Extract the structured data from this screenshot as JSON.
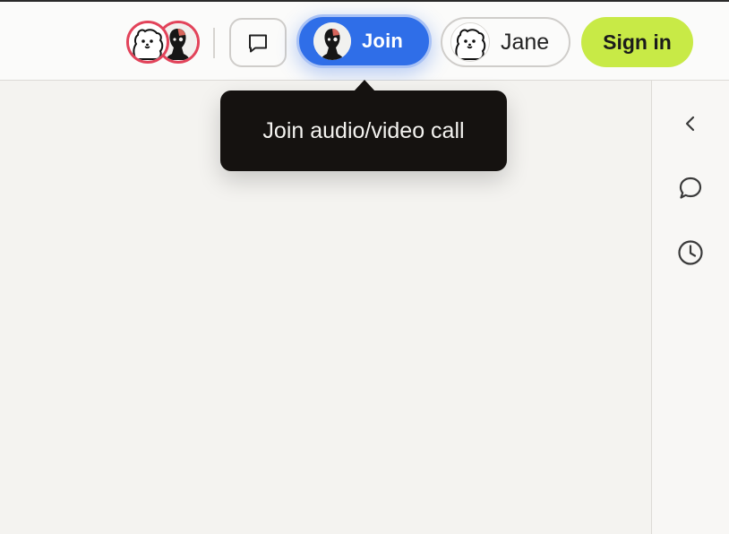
{
  "topbar": {
    "participants": [
      {
        "name": "bear-avatar"
      },
      {
        "name": "person-avatar"
      }
    ],
    "join_label": "Join",
    "user_name": "Jane",
    "signin_label": "Sign in",
    "accent_color": "#2f6ee8",
    "signin_color": "#c8ea46",
    "presence_ring_color": "#e2435a"
  },
  "tooltip": {
    "text": "Join audio/video call"
  },
  "rightbar": {
    "icons": [
      "chevron-left-icon",
      "comment-icon",
      "clock-icon"
    ]
  }
}
